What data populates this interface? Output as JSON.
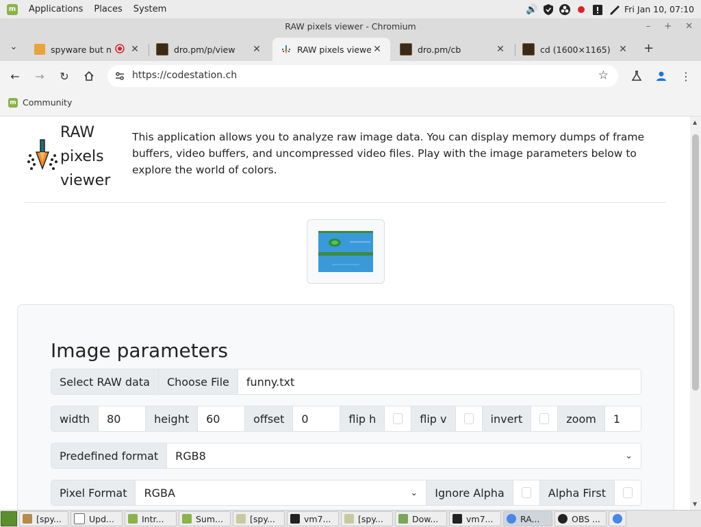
{
  "system_panel": {
    "menus": [
      "Applications",
      "Places",
      "System"
    ],
    "clock": "Fri Jan 10, 07:10"
  },
  "window": {
    "title": "RAW pixels viewer - Chromium",
    "controls": {
      "minimize": "–",
      "maximize": "+",
      "close": "✕"
    }
  },
  "tabs": [
    {
      "title": "spyware but n",
      "icon": "recording-dot-icon",
      "active": false
    },
    {
      "title": "dro.pm/p/view",
      "icon": "page-thumbnail-icon",
      "active": false
    },
    {
      "title": "RAW pixels viewer",
      "icon": "app-logo-icon",
      "active": true
    },
    {
      "title": "dro.pm/cb",
      "icon": "page-thumbnail-icon",
      "active": false
    },
    {
      "title": "cd (1600×1165)",
      "icon": "page-thumbnail-icon",
      "active": false
    }
  ],
  "omnibox": {
    "url": "https://codestation.ch"
  },
  "bookmarks": [
    {
      "label": "Community"
    }
  ],
  "page": {
    "app_title_lines": [
      "RAW",
      "pixels",
      "viewer"
    ],
    "intro": "This application allows you to analyze raw image data. You can display memory dumps of frame buffers, video buffers, and uncompressed video files. Play with the image parameters below to explore the world of colors.",
    "params": {
      "heading": "Image parameters",
      "file_row": {
        "label": "Select RAW data",
        "button": "Choose File",
        "filename": "funny.txt"
      },
      "dims_row": {
        "width_label": "width",
        "width_value": "80",
        "height_label": "height",
        "height_value": "60",
        "offset_label": "offset",
        "offset_value": "0",
        "flip_h_label": "flip h",
        "flip_h_checked": false,
        "flip_v_label": "flip v",
        "flip_v_checked": false,
        "invert_label": "invert",
        "invert_checked": false,
        "zoom_label": "zoom",
        "zoom_value": "1"
      },
      "predefined_row": {
        "label": "Predefined format",
        "value": "RGB8"
      },
      "pixel_row": {
        "label": "Pixel Format",
        "value": "RGBA",
        "ignore_alpha_label": "Ignore Alpha",
        "ignore_alpha_checked": false,
        "alpha_first_label": "Alpha First",
        "alpha_first_checked": false
      }
    }
  },
  "taskbar": [
    {
      "label": "[spy...",
      "icon": "folder-icon"
    },
    {
      "label": "Upd...",
      "icon": "shield-icon"
    },
    {
      "label": "Intr...",
      "icon": "mint-icon"
    },
    {
      "label": "Sum...",
      "icon": "mint-icon"
    },
    {
      "label": "[spy...",
      "icon": "folder-icon"
    },
    {
      "label": "vm7...",
      "icon": "terminal-icon"
    },
    {
      "label": "[spy...",
      "icon": "folder-icon"
    },
    {
      "label": "Dow...",
      "icon": "folder-icon"
    },
    {
      "label": "vm7...",
      "icon": "terminal-icon"
    },
    {
      "label": "RA...",
      "icon": "chromium-icon",
      "active": true
    },
    {
      "label": "OBS ...",
      "icon": "obs-icon"
    },
    {
      "label": "",
      "icon": "chromium-icon"
    }
  ],
  "colors": {
    "panel_bg": "#ececec",
    "tab_strip_bg": "#dcdcdc",
    "chrome_bg": "#f3f3f3",
    "input_group_label_bg": "#e9ecef",
    "card_bg": "#f8f9fa",
    "preview_blue": "#3a9ad9",
    "preview_green": "#3c8a3c"
  }
}
